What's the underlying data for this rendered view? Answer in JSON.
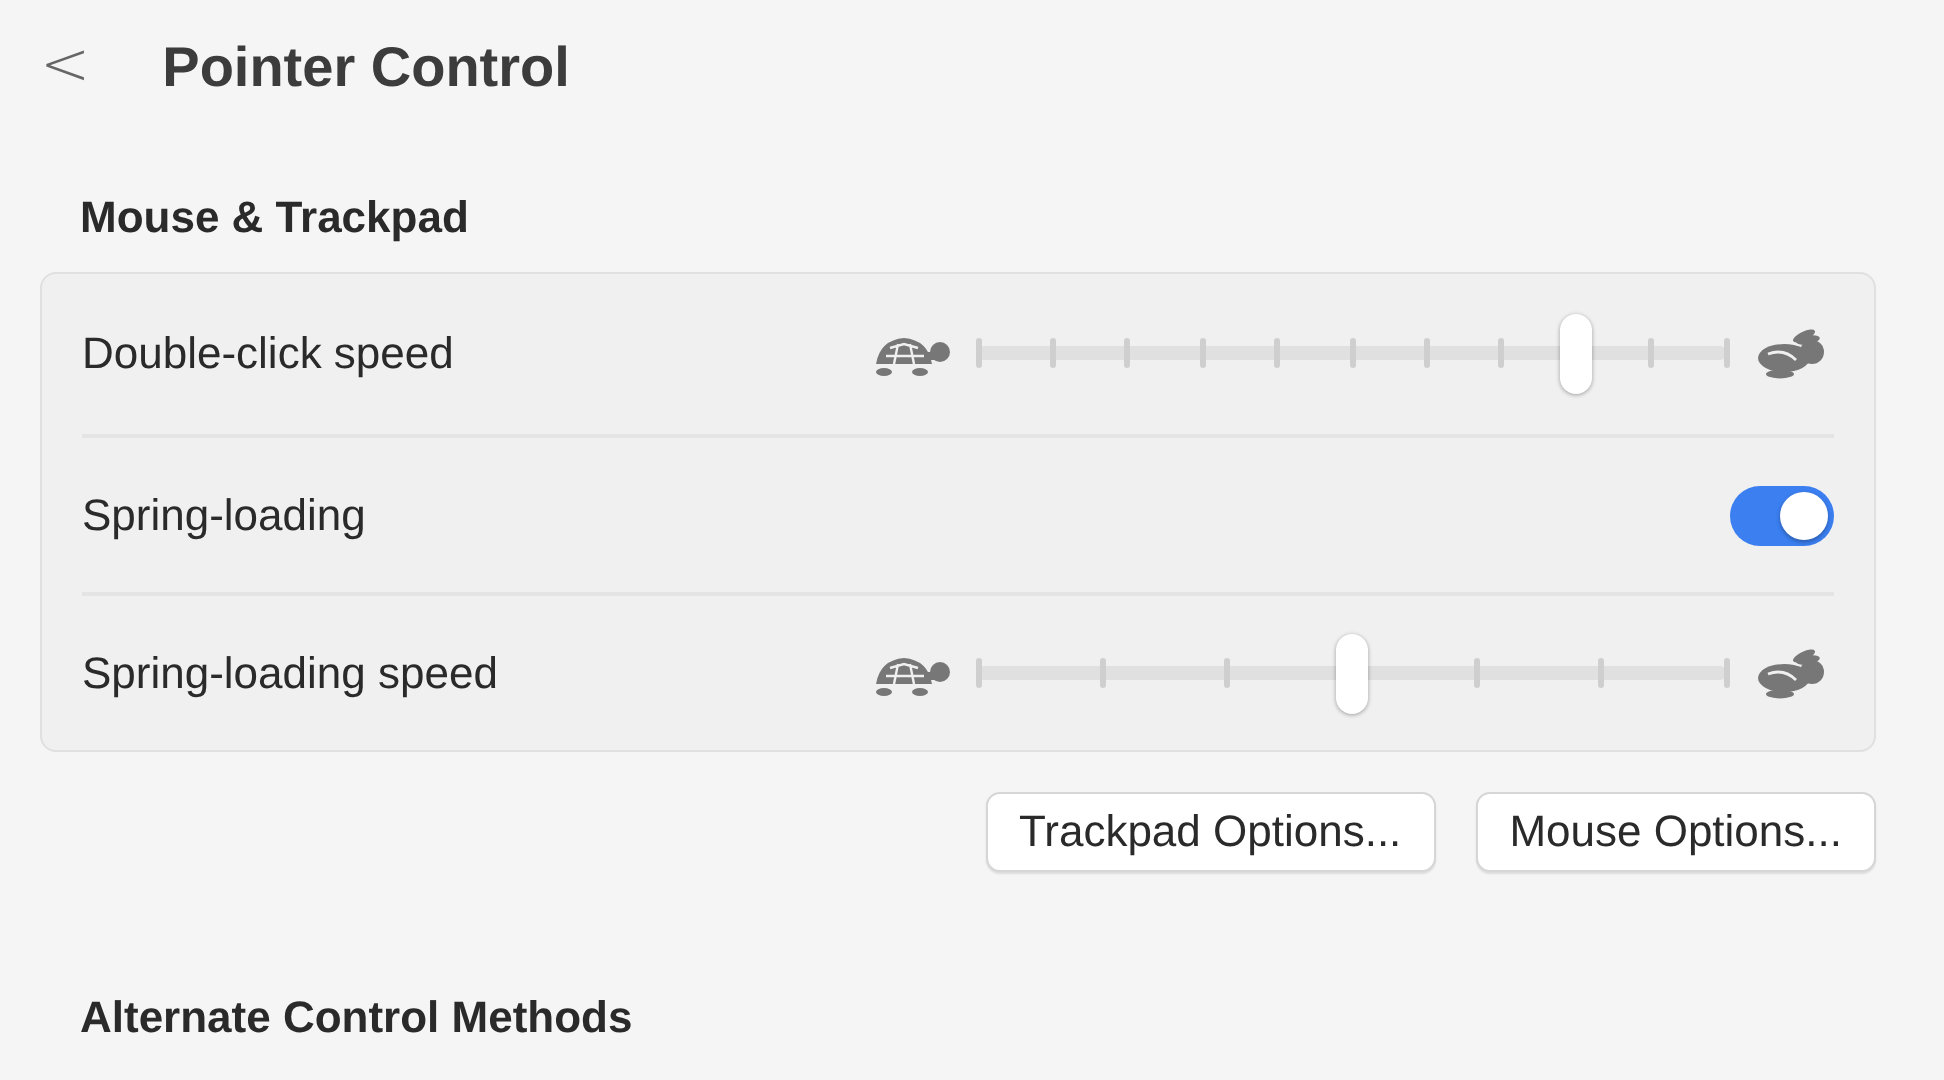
{
  "header": {
    "back": "<",
    "title": "Pointer Control"
  },
  "section": "Mouse & Trackpad",
  "rows": [
    {
      "kind": "fineslider",
      "label": "Double-click speed",
      "level": 0.8
    },
    {
      "kind": "toggle",
      "label": "Spring-loading",
      "on": true
    },
    {
      "kind": "coarseslider",
      "label": "Spring-loading speed",
      "level": 0.5
    }
  ],
  "buttons": [
    "Trackpad Options...",
    "Mouse Options..."
  ],
  "next_section": "Alternate Control Methods"
}
